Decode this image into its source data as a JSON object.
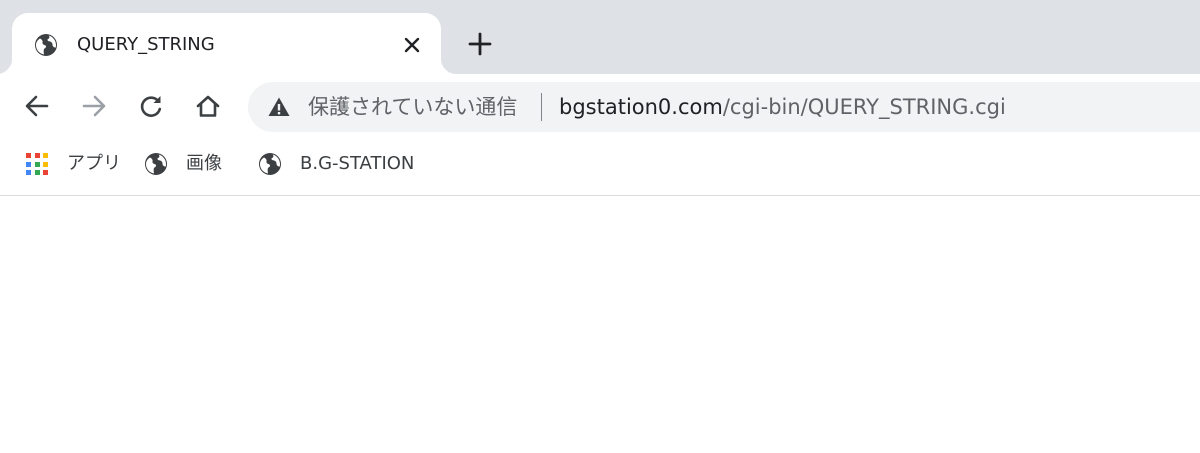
{
  "tab": {
    "title": "QUERY_STRING",
    "favicon_icon": "globe-icon",
    "close_icon": "close-icon"
  },
  "new_tab_icon": "plus-icon",
  "toolbar": {
    "back_icon": "arrow-left-icon",
    "forward_icon": "arrow-right-icon",
    "reload_icon": "reload-icon",
    "home_icon": "home-icon"
  },
  "omnibox": {
    "security_icon": "warning-icon",
    "security_text": "保護されていない通信",
    "url_host": "bgstation0.com",
    "url_path": "/cgi-bin/QUERY_STRING.cgi"
  },
  "bookmarks": [
    {
      "label": "アプリ",
      "icon": "apps-grid-icon"
    },
    {
      "label": "画像",
      "icon": "globe-icon"
    },
    {
      "label": "B.G-STATION",
      "icon": "globe-icon"
    }
  ],
  "colors": {
    "tabstrip_bg": "#dee1e6",
    "omnibox_bg": "#f1f3f4",
    "icon_dark": "#3c4043",
    "icon_disabled": "#9aa0a6",
    "text_secondary": "#5f6368"
  }
}
